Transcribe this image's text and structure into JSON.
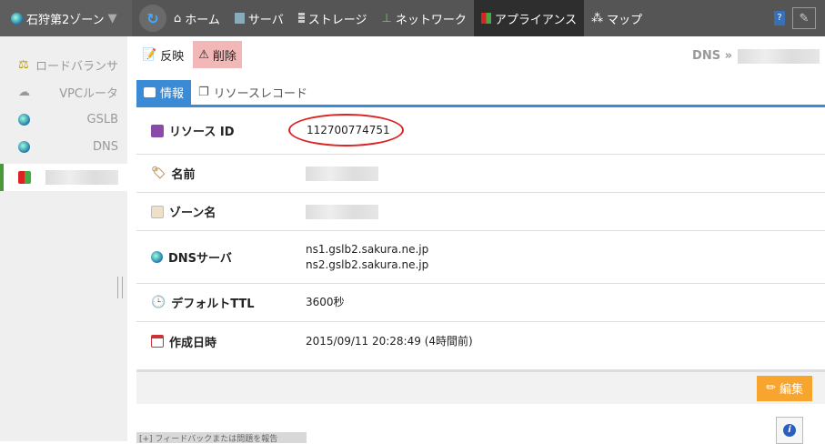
{
  "topbar": {
    "zone": "石狩第2ゾーン",
    "nav": [
      {
        "label": "ホーム",
        "icon": "home-icon"
      },
      {
        "label": "サーバ",
        "icon": "server-icon"
      },
      {
        "label": "ストレージ",
        "icon": "storage-icon"
      },
      {
        "label": "ネットワーク",
        "icon": "network-icon"
      },
      {
        "label": "アプライアンス",
        "icon": "appliance-icon",
        "active": true
      },
      {
        "label": "マップ",
        "icon": "map-icon"
      }
    ],
    "help": "?"
  },
  "sidebar": {
    "items": [
      {
        "label": "ロードバランサ"
      },
      {
        "label": "VPCルータ"
      },
      {
        "label": "GSLB"
      },
      {
        "label": "DNS"
      }
    ]
  },
  "toolbar": {
    "apply": "反映",
    "delete": "削除"
  },
  "breadcrumb": {
    "root": "DNS »"
  },
  "tabs": [
    {
      "label": "情報",
      "active": true
    },
    {
      "label": "リソースレコード"
    }
  ],
  "details": {
    "resource_id": {
      "label": "リソース ID",
      "value": "112700774751"
    },
    "name": {
      "label": "名前"
    },
    "zone_name": {
      "label": "ゾーン名"
    },
    "dns_servers": {
      "label": "DNSサーバ",
      "values": [
        "ns1.gslb2.sakura.ne.jp",
        "ns2.gslb2.sakura.ne.jp"
      ]
    },
    "ttl": {
      "label": "デフォルトTTL",
      "value": "3600秒"
    },
    "created": {
      "label": "作成日時",
      "value": "2015/09/11 20:28:49 (4時間前)"
    }
  },
  "footer": {
    "edit": "編集",
    "feedback": "[+] フィードバックまたは問題を報告"
  },
  "colors": {
    "accent": "#3a8ad6",
    "edit": "#f7a52e",
    "highlight": "#d22222"
  }
}
